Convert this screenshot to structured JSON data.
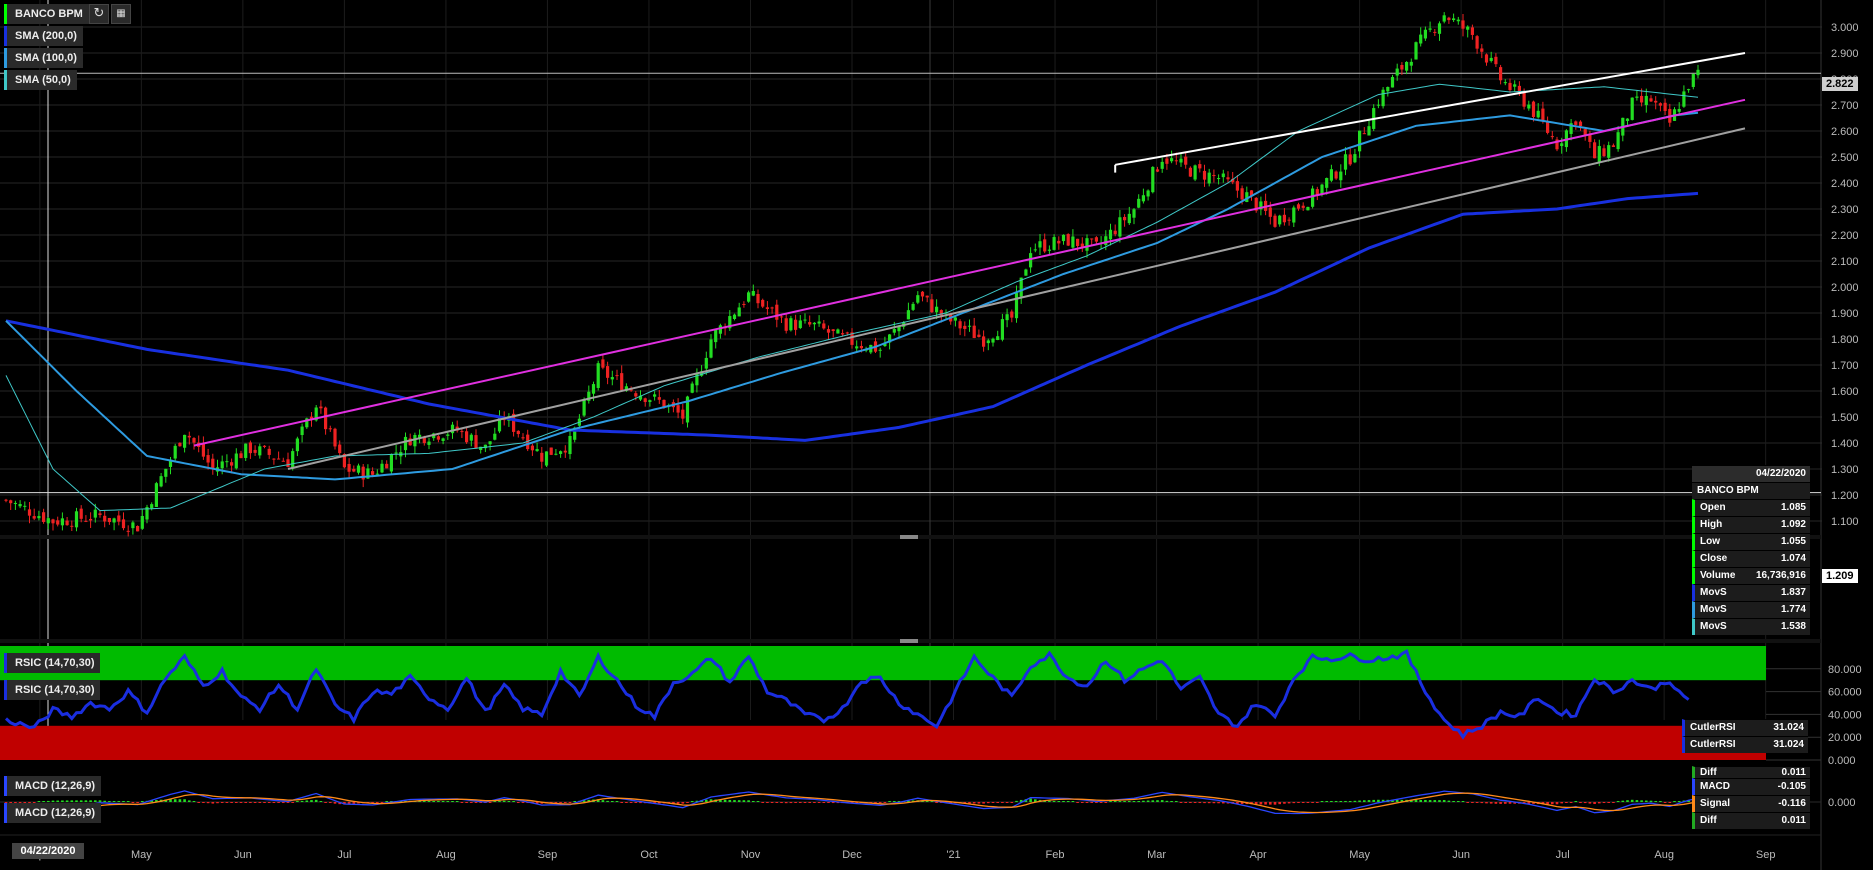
{
  "toolbar": {
    "symbol": "BANCO BPM",
    "refresh_icon": "refresh-icon",
    "calendar_icon": "calendar-icon"
  },
  "legends": {
    "main": [
      "SMA (200,0)",
      "SMA (100,0)",
      "SMA (50,0)"
    ],
    "rsi": [
      "RSIC (14,70,30)",
      "RSIC (14,70,30)"
    ],
    "macd": [
      "MACD (12,26,9)",
      "MACD (12,26,9)"
    ]
  },
  "colors": {
    "up": "#22dd22",
    "down": "#ee2222",
    "sma200": "#1830e0",
    "sma100": "#2e9be0",
    "sma50": "#3fc8c8",
    "trend_magenta": "#e030e0",
    "trend_white": "#ffffff",
    "trend_gray": "#a0a0a0",
    "rsi_line": "#1a2ee0",
    "rsi_overbought": "#00bb00",
    "rsi_oversold": "#c00000",
    "macd_line": "#2a46ff",
    "signal_line": "#ff8a1a"
  },
  "price_tags": {
    "last": "2.822",
    "crosshair": "1.209"
  },
  "crosshair_date": "04/22/2020",
  "info_panel": {
    "date": "04/22/2020",
    "name": "BANCO BPM",
    "rows": [
      {
        "label": "Open",
        "value": "1.085"
      },
      {
        "label": "High",
        "value": "1.092"
      },
      {
        "label": "Low",
        "value": "1.055"
      },
      {
        "label": "Close",
        "value": "1.074"
      },
      {
        "label": "Volume",
        "value": "16,736,916"
      },
      {
        "label": "MovS",
        "value": "1.837"
      },
      {
        "label": "MovS",
        "value": "1.774"
      },
      {
        "label": "MovS",
        "value": "1.538"
      }
    ]
  },
  "rsi_panel": {
    "rows": [
      {
        "label": "CutlerRSI",
        "value": "31.024"
      },
      {
        "label": "CutlerRSI",
        "value": "31.024"
      }
    ]
  },
  "macd_panel": {
    "rows": [
      {
        "label": "Diff",
        "value": "0.011"
      },
      {
        "label": "MACD",
        "value": "-0.105"
      },
      {
        "label": "Signal",
        "value": "-0.116"
      },
      {
        "label": "Diff",
        "value": "0.011"
      }
    ]
  },
  "chart_data": {
    "type": "candlestick",
    "title": "BANCO BPM",
    "x_labels": [
      "Apr",
      "May",
      "Jun",
      "Jul",
      "Aug",
      "Sep",
      "Oct",
      "Nov",
      "Dec",
      "'21",
      "Feb",
      "Mar",
      "Apr",
      "May",
      "Jun",
      "Jul",
      "Aug",
      "Sep"
    ],
    "y_ticks": [
      "1.100",
      "1.200",
      "1.300",
      "1.400",
      "1.500",
      "1.600",
      "1.700",
      "1.800",
      "1.900",
      "2.000",
      "2.100",
      "2.200",
      "2.300",
      "2.400",
      "2.500",
      "2.600",
      "2.700",
      "2.800",
      "2.900",
      "3.000"
    ],
    "ylim": [
      1.0,
      3.05
    ],
    "close_anchors": [
      [
        0,
        1.18
      ],
      [
        10,
        1.1
      ],
      [
        20,
        1.12
      ],
      [
        28,
        1.08
      ],
      [
        38,
        1.45
      ],
      [
        44,
        1.3
      ],
      [
        52,
        1.38
      ],
      [
        60,
        1.33
      ],
      [
        66,
        1.55
      ],
      [
        72,
        1.3
      ],
      [
        78,
        1.28
      ],
      [
        86,
        1.42
      ],
      [
        96,
        1.45
      ],
      [
        102,
        1.38
      ],
      [
        106,
        1.5
      ],
      [
        114,
        1.35
      ],
      [
        120,
        1.4
      ],
      [
        126,
        1.68
      ],
      [
        134,
        1.6
      ],
      [
        140,
        1.55
      ],
      [
        144,
        1.5
      ],
      [
        150,
        1.8
      ],
      [
        158,
        1.97
      ],
      [
        166,
        1.86
      ],
      [
        172,
        1.85
      ],
      [
        178,
        1.8
      ],
      [
        186,
        1.76
      ],
      [
        190,
        1.85
      ],
      [
        194,
        1.97
      ],
      [
        200,
        1.88
      ],
      [
        208,
        1.8
      ],
      [
        214,
        1.88
      ],
      [
        218,
        2.15
      ],
      [
        226,
        2.18
      ],
      [
        232,
        2.15
      ],
      [
        240,
        2.3
      ],
      [
        246,
        2.5
      ],
      [
        252,
        2.45
      ],
      [
        258,
        2.42
      ],
      [
        264,
        2.35
      ],
      [
        270,
        2.25
      ],
      [
        278,
        2.35
      ],
      [
        286,
        2.5
      ],
      [
        292,
        2.72
      ],
      [
        300,
        2.92
      ],
      [
        306,
        3.05
      ],
      [
        312,
        2.97
      ],
      [
        318,
        2.8
      ],
      [
        324,
        2.7
      ],
      [
        330,
        2.55
      ],
      [
        334,
        2.65
      ],
      [
        338,
        2.5
      ],
      [
        342,
        2.55
      ],
      [
        346,
        2.7
      ],
      [
        350,
        2.72
      ],
      [
        354,
        2.63
      ],
      [
        358,
        2.78
      ],
      [
        360,
        2.82
      ]
    ],
    "series": [
      {
        "name": "SMA (200,0)",
        "anchors": [
          [
            0,
            1.87
          ],
          [
            30,
            1.76
          ],
          [
            60,
            1.68
          ],
          [
            90,
            1.55
          ],
          [
            120,
            1.45
          ],
          [
            150,
            1.43
          ],
          [
            170,
            1.41
          ],
          [
            190,
            1.46
          ],
          [
            210,
            1.54
          ],
          [
            230,
            1.7
          ],
          [
            250,
            1.85
          ],
          [
            270,
            1.98
          ],
          [
            290,
            2.15
          ],
          [
            310,
            2.28
          ],
          [
            330,
            2.3
          ],
          [
            345,
            2.34
          ],
          [
            360,
            2.36
          ]
        ]
      },
      {
        "name": "SMA (100,0)",
        "anchors": [
          [
            0,
            1.87
          ],
          [
            15,
            1.6
          ],
          [
            30,
            1.35
          ],
          [
            50,
            1.28
          ],
          [
            70,
            1.26
          ],
          [
            95,
            1.3
          ],
          [
            120,
            1.45
          ],
          [
            145,
            1.56
          ],
          [
            165,
            1.67
          ],
          [
            185,
            1.77
          ],
          [
            205,
            1.91
          ],
          [
            225,
            2.05
          ],
          [
            245,
            2.17
          ],
          [
            260,
            2.3
          ],
          [
            280,
            2.5
          ],
          [
            300,
            2.62
          ],
          [
            320,
            2.66
          ],
          [
            340,
            2.6
          ],
          [
            355,
            2.66
          ],
          [
            360,
            2.67
          ]
        ]
      },
      {
        "name": "SMA (50,0)",
        "anchors": [
          [
            0,
            1.66
          ],
          [
            10,
            1.3
          ],
          [
            20,
            1.14
          ],
          [
            35,
            1.15
          ],
          [
            55,
            1.3
          ],
          [
            70,
            1.35
          ],
          [
            90,
            1.36
          ],
          [
            110,
            1.4
          ],
          [
            125,
            1.5
          ],
          [
            140,
            1.62
          ],
          [
            160,
            1.73
          ],
          [
            180,
            1.82
          ],
          [
            200,
            1.9
          ],
          [
            215,
            2.02
          ],
          [
            230,
            2.12
          ],
          [
            245,
            2.25
          ],
          [
            260,
            2.4
          ],
          [
            275,
            2.6
          ],
          [
            292,
            2.74
          ],
          [
            305,
            2.78
          ],
          [
            320,
            2.75
          ],
          [
            340,
            2.77
          ],
          [
            355,
            2.74
          ],
          [
            360,
            2.73
          ]
        ]
      }
    ],
    "trendlines": [
      {
        "name": "magenta",
        "from": [
          40,
          1.39
        ],
        "to": [
          370,
          2.72
        ]
      },
      {
        "name": "gray",
        "from": [
          60,
          1.3
        ],
        "to": [
          370,
          2.61
        ]
      },
      {
        "name": "white",
        "from": [
          236,
          2.47
        ],
        "to": [
          370,
          2.9
        ]
      }
    ],
    "rsi": {
      "y_ticks": [
        "80.000",
        "60.000",
        "40.000",
        "20.000",
        "0.000"
      ],
      "overbought": 70,
      "oversold": 30,
      "anchors": [
        [
          0,
          35
        ],
        [
          6,
          28
        ],
        [
          10,
          44
        ],
        [
          14,
          38
        ],
        [
          18,
          50
        ],
        [
          22,
          45
        ],
        [
          26,
          60
        ],
        [
          30,
          42
        ],
        [
          34,
          72
        ],
        [
          38,
          90
        ],
        [
          42,
          65
        ],
        [
          46,
          78
        ],
        [
          50,
          55
        ],
        [
          54,
          45
        ],
        [
          58,
          66
        ],
        [
          62,
          45
        ],
        [
          66,
          80
        ],
        [
          70,
          48
        ],
        [
          74,
          36
        ],
        [
          78,
          60
        ],
        [
          82,
          58
        ],
        [
          86,
          72
        ],
        [
          90,
          55
        ],
        [
          94,
          45
        ],
        [
          98,
          72
        ],
        [
          102,
          42
        ],
        [
          106,
          65
        ],
        [
          110,
          45
        ],
        [
          114,
          40
        ],
        [
          118,
          78
        ],
        [
          122,
          55
        ],
        [
          126,
          90
        ],
        [
          130,
          70
        ],
        [
          134,
          48
        ],
        [
          138,
          38
        ],
        [
          142,
          68
        ],
        [
          146,
          75
        ],
        [
          150,
          90
        ],
        [
          154,
          68
        ],
        [
          158,
          91
        ],
        [
          162,
          60
        ],
        [
          166,
          52
        ],
        [
          170,
          40
        ],
        [
          174,
          35
        ],
        [
          178,
          45
        ],
        [
          182,
          70
        ],
        [
          186,
          72
        ],
        [
          190,
          50
        ],
        [
          194,
          40
        ],
        [
          198,
          30
        ],
        [
          202,
          60
        ],
        [
          206,
          90
        ],
        [
          210,
          72
        ],
        [
          214,
          55
        ],
        [
          218,
          83
        ],
        [
          222,
          92
        ],
        [
          226,
          72
        ],
        [
          230,
          65
        ],
        [
          234,
          88
        ],
        [
          238,
          70
        ],
        [
          242,
          80
        ],
        [
          246,
          88
        ],
        [
          250,
          62
        ],
        [
          254,
          72
        ],
        [
          258,
          40
        ],
        [
          262,
          30
        ],
        [
          266,
          50
        ],
        [
          270,
          38
        ],
        [
          274,
          72
        ],
        [
          278,
          90
        ],
        [
          282,
          89
        ],
        [
          286,
          91
        ],
        [
          290,
          88
        ],
        [
          294,
          90
        ],
        [
          298,
          93
        ],
        [
          302,
          60
        ],
        [
          306,
          35
        ],
        [
          310,
          22
        ],
        [
          314,
          30
        ],
        [
          318,
          42
        ],
        [
          322,
          38
        ],
        [
          326,
          55
        ],
        [
          330,
          42
        ],
        [
          334,
          40
        ],
        [
          338,
          72
        ],
        [
          342,
          60
        ],
        [
          346,
          70
        ],
        [
          350,
          62
        ],
        [
          354,
          70
        ],
        [
          356,
          58
        ],
        [
          358,
          52
        ]
      ]
    },
    "macd": {
      "y_ticks": [
        "0.000"
      ]
    }
  }
}
